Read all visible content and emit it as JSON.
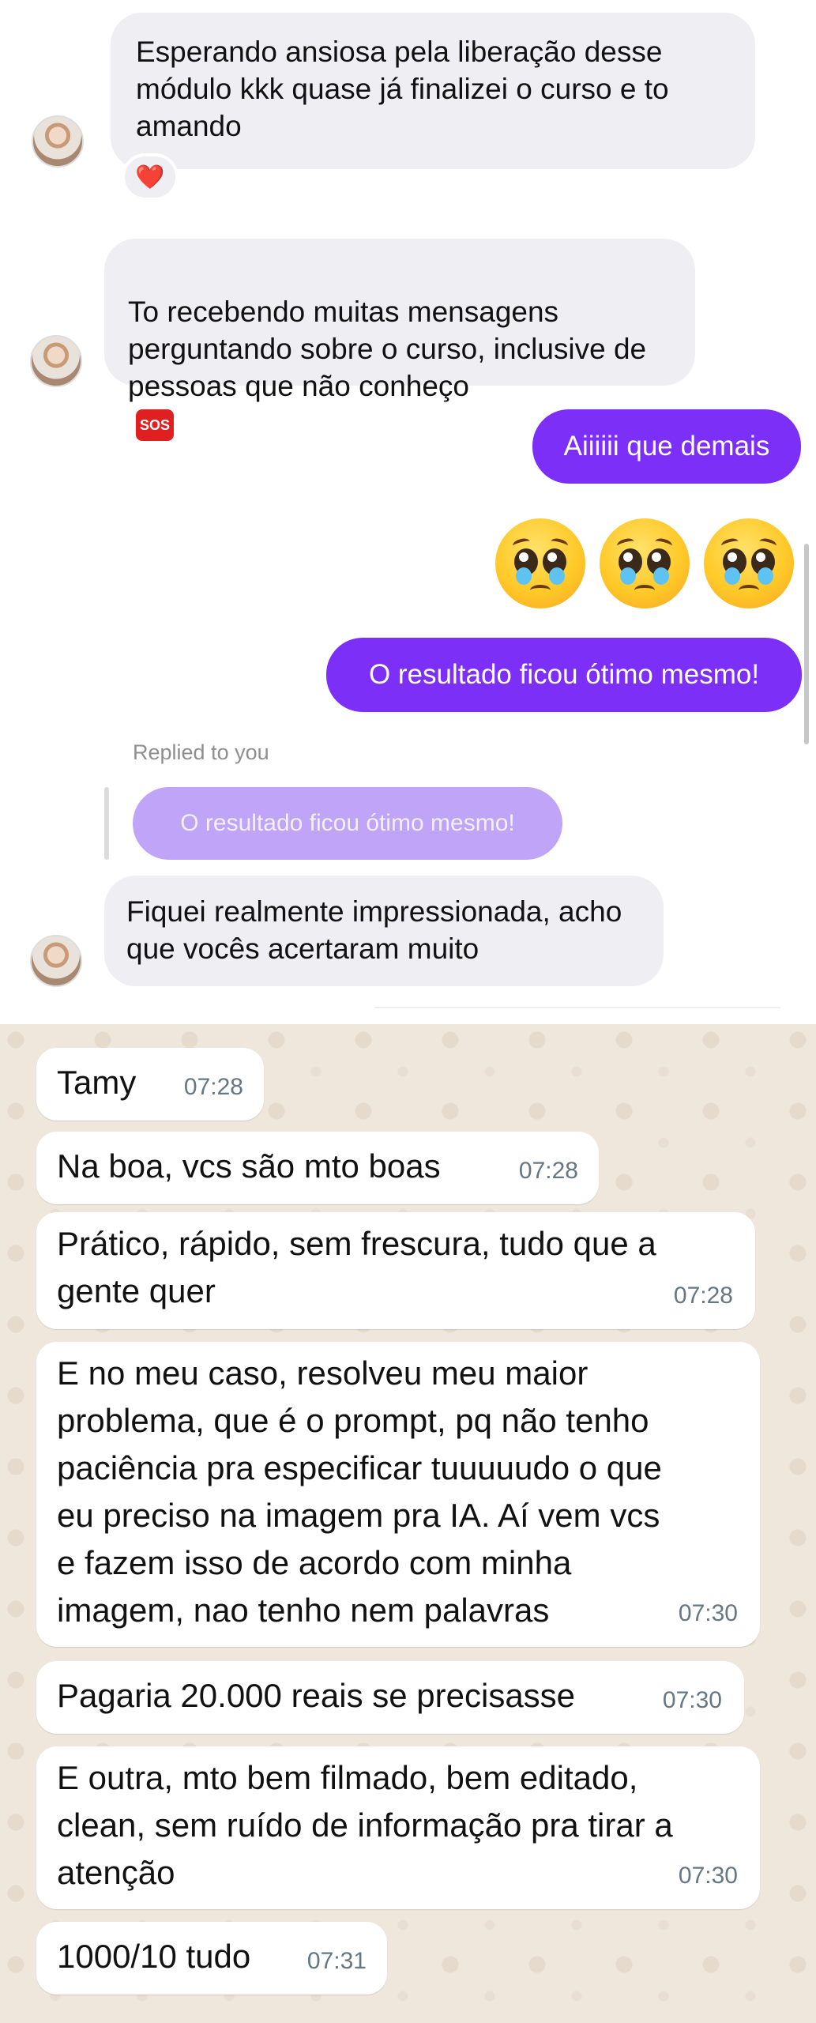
{
  "instagram": {
    "messages": [
      {
        "text": "Esperando ansiosa pela liberação desse\nmódulo kkk quase já finalizei o curso e to\namando",
        "reaction": "❤️"
      },
      {
        "text": "To recebendo muitas mensagens\nperguntando sobre o curso, inclusive de\npessoas que não conheço",
        "emoji": "SOS"
      },
      {
        "sent_text": "Aiiiiii que demais"
      },
      {
        "sent_text": "O resultado ficou ótimo mesmo!"
      },
      {
        "reply_label": "Replied to you",
        "quoted_text": "O resultado ficou ótimo mesmo!"
      },
      {
        "text": "Fiquei realmente impressionada, acho\nque vocês acertaram muito"
      }
    ]
  },
  "whatsapp": {
    "messages": [
      {
        "text": "Tamy",
        "time": "07:28"
      },
      {
        "text": "Na boa, vcs são mto boas",
        "time": "07:28"
      },
      {
        "text": "Prático, rápido, sem frescura, tudo que a\ngente quer",
        "time": "07:28"
      },
      {
        "text": "E no meu caso, resolveu meu maior\nproblema, que é o prompt, pq não tenho\npaciência pra especificar tuuuuudo o que\neu preciso na imagem pra IA. Aí vem vcs\ne fazem isso de acordo com minha\nimagem, nao tenho nem palavras",
        "time": "07:30"
      },
      {
        "text": "Pagaria 20.000 reais se precisasse",
        "time": "07:30"
      },
      {
        "text": "E outra, mto bem filmado, bem editado,\nclean, sem ruído de informação pra tirar a\natenção",
        "time": "07:30"
      },
      {
        "text": "1000/10 tudo",
        "time": "07:31"
      }
    ]
  },
  "colors": {
    "ig_sent": "#7b2ff7",
    "ig_received": "#efeff3",
    "wa_bg": "#efe7dc",
    "wa_time": "#667781"
  }
}
